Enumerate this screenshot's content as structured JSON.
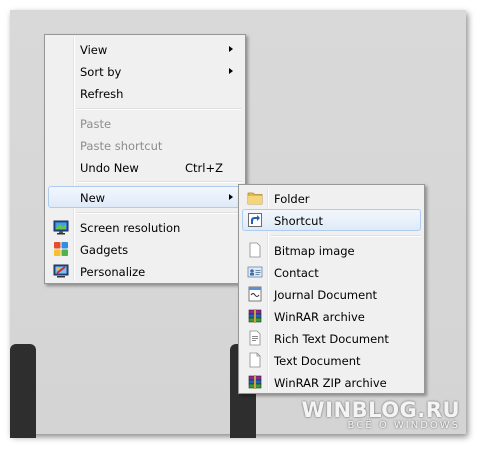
{
  "context_menu": {
    "items": [
      {
        "label": "View",
        "submenu": true
      },
      {
        "label": "Sort by",
        "submenu": true
      },
      {
        "label": "Refresh"
      },
      {
        "label": "Paste",
        "disabled": true
      },
      {
        "label": "Paste shortcut",
        "disabled": true
      },
      {
        "label": "Undo New",
        "shortcut": "Ctrl+Z"
      },
      {
        "label": "New",
        "submenu": true,
        "highlighted": true
      },
      {
        "label": "Screen resolution",
        "icon": "monitor-icon"
      },
      {
        "label": "Gadgets",
        "icon": "gadgets-icon"
      },
      {
        "label": "Personalize",
        "icon": "personalize-icon"
      }
    ]
  },
  "new_submenu": {
    "items": [
      {
        "label": "Folder",
        "icon": "folder-icon"
      },
      {
        "label": "Shortcut",
        "icon": "shortcut-icon",
        "highlighted": true
      },
      {
        "label": "Bitmap image",
        "icon": "bitmap-icon"
      },
      {
        "label": "Contact",
        "icon": "contact-icon"
      },
      {
        "label": "Journal Document",
        "icon": "journal-icon"
      },
      {
        "label": "WinRAR archive",
        "icon": "winrar-icon"
      },
      {
        "label": "Rich Text Document",
        "icon": "rtf-document-icon"
      },
      {
        "label": "Text Document",
        "icon": "text-document-icon"
      },
      {
        "label": "WinRAR ZIP archive",
        "icon": "winrar-zip-icon"
      }
    ]
  },
  "watermark": {
    "main": "WINBLOG.RU",
    "sub": "ВСЁ О WINDOWS"
  },
  "colors": {
    "menu_bg": "#f0f0f0",
    "menu_border": "#979797",
    "highlight_border": "#aeccf0",
    "disabled_text": "#8d8d8d"
  }
}
